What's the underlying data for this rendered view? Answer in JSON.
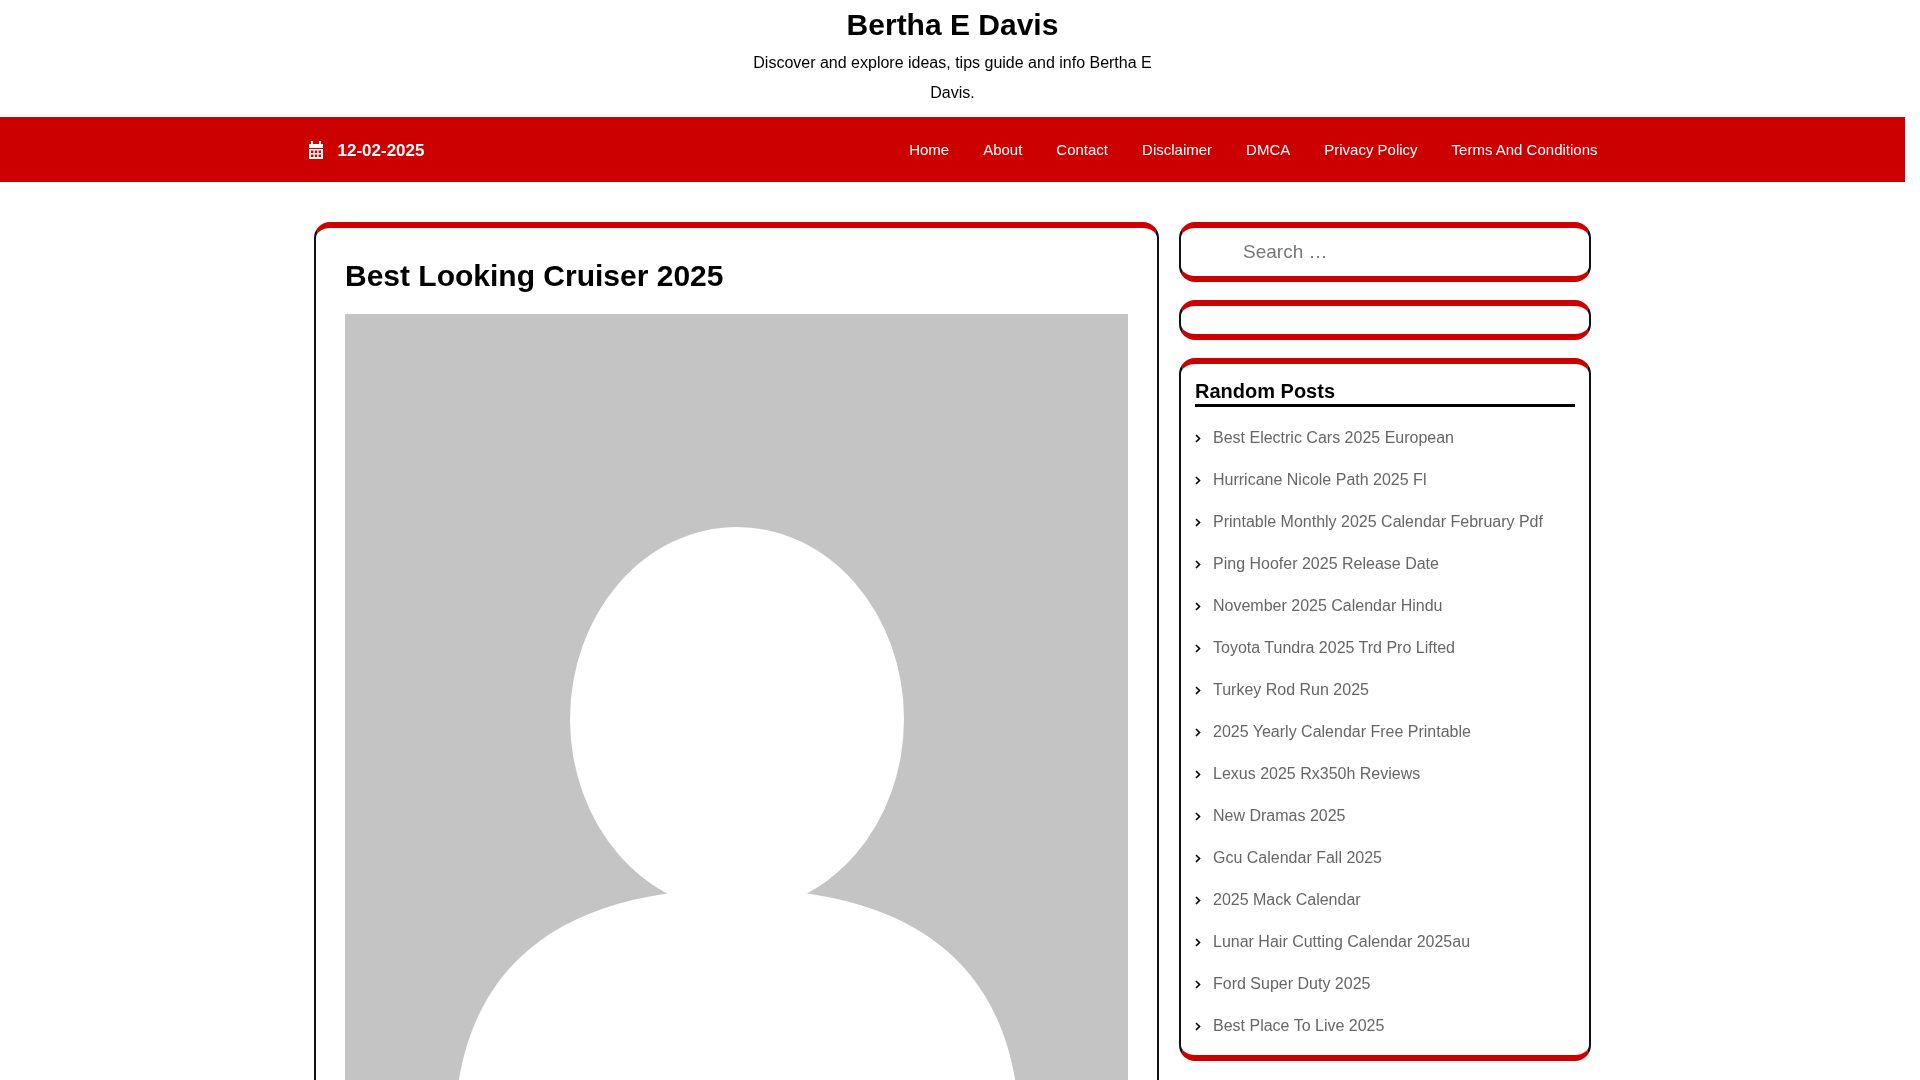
{
  "site": {
    "title": "Bertha E Davis",
    "tagline": "Discover and explore ideas, tips guide and info Bertha E Davis."
  },
  "nav": {
    "date": "12-02-2025",
    "links": [
      {
        "label": "Home"
      },
      {
        "label": "About"
      },
      {
        "label": "Contact"
      },
      {
        "label": "Disclaimer"
      },
      {
        "label": "DMCA"
      },
      {
        "label": "Privacy Policy"
      },
      {
        "label": "Terms And Conditions"
      }
    ]
  },
  "article": {
    "title": "Best Looking Cruiser 2025",
    "image": {
      "kind": "placeholder-avatar"
    }
  },
  "sidebar": {
    "search": {
      "placeholder": "Search …"
    },
    "random_posts": {
      "heading": "Random Posts",
      "items": [
        "Best Electric Cars 2025 European",
        "Hurricane Nicole Path 2025 Fl",
        "Printable Monthly 2025 Calendar February Pdf",
        "Ping Hoofer 2025 Release Date",
        "November 2025 Calendar Hindu",
        "Toyota Tundra 2025 Trd Pro Lifted",
        "Turkey Rod Run 2025",
        "2025 Yearly Calendar Free Printable",
        "Lexus 2025 Rx350h Reviews",
        "New Dramas 2025",
        "Gcu Calendar Fall 2025",
        "2025 Mack Calendar",
        "Lunar Hair Cutting Calendar 2025au",
        "Ford Super Duty 2025",
        "Best Place To Live 2025"
      ]
    }
  }
}
